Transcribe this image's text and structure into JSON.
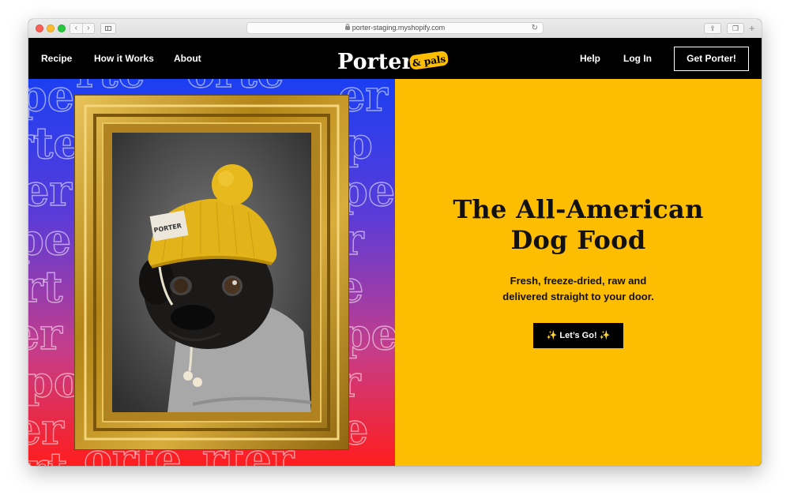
{
  "browser": {
    "url": "porter-staging.myshopify.com",
    "back_glyph": "‹",
    "forward_glyph": "›",
    "reload_glyph": "↻",
    "share_glyph": "⇪",
    "tabs_glyph": "❐",
    "newtab_glyph": "+"
  },
  "nav": {
    "left_links": [
      "Recipe",
      "How it Works",
      "About"
    ],
    "right_links": [
      "Help",
      "Log In"
    ],
    "cta": "Get Porter!",
    "logo_main": "Porter",
    "logo_badge": "& pals"
  },
  "hero": {
    "headline_line1": "The All-American",
    "headline_line2": "Dog Food",
    "sub_line1": "Fresh, freeze-dried, raw and",
    "sub_line2": "delivered straight to your door.",
    "button": "✨ Let’s Go! ✨",
    "hat_patch": "PORTER"
  },
  "colors": {
    "accent_yellow": "#fdbd00",
    "nav_bg": "#000000",
    "gradient_top": "#1b3ff2",
    "gradient_bottom": "#ff1d1d",
    "frame_gold": "#c99a1f",
    "hat_yellow": "#e3b41a"
  },
  "icons": [
    "lock-icon",
    "reload-icon",
    "share-icon",
    "tabs-icon",
    "sidebar-icon",
    "back-icon",
    "forward-icon"
  ]
}
